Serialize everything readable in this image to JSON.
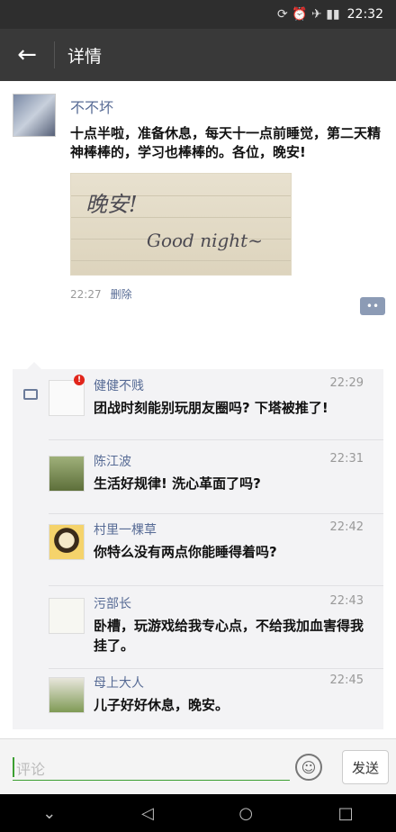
{
  "statusbar": {
    "icons": "⟳ ⏰ ✈ ▮▮",
    "time": "22:32"
  },
  "header": {
    "title": "详情"
  },
  "post": {
    "author": "不不坏",
    "text": "十点半啦，准备休息，每天十一点前睡觉，第二天精神棒棒的，学习也棒棒的。各位，晚安!",
    "image_text_1": "晚安!",
    "image_text_2": "Good night~",
    "time": "22:27",
    "delete_label": "删除",
    "comment_button_icon": "comment-bubble-icon"
  },
  "comments": [
    {
      "name": "健健不贱",
      "time": "22:29",
      "text": "团战时刻能别玩朋友圈吗? 下塔被推了!",
      "badge": "!"
    },
    {
      "name": "陈江波",
      "time": "22:31",
      "text": "生活好规律! 洗心革面了吗?"
    },
    {
      "name": "村里一棵草",
      "time": "22:42",
      "text": "你特么没有两点你能睡得着吗?"
    },
    {
      "name": "污部长",
      "time": "22:43",
      "text": "卧槽，玩游戏给我专心点，不给我加血害得我挂了。"
    },
    {
      "name": "母上大人",
      "time": "22:45",
      "text": "儿子好好休息，晚安。"
    }
  ],
  "input": {
    "placeholder": "评论",
    "send_label": "发送"
  },
  "colors": {
    "link": "#576b95",
    "accent": "#3c9f32",
    "appbar": "#393939"
  }
}
